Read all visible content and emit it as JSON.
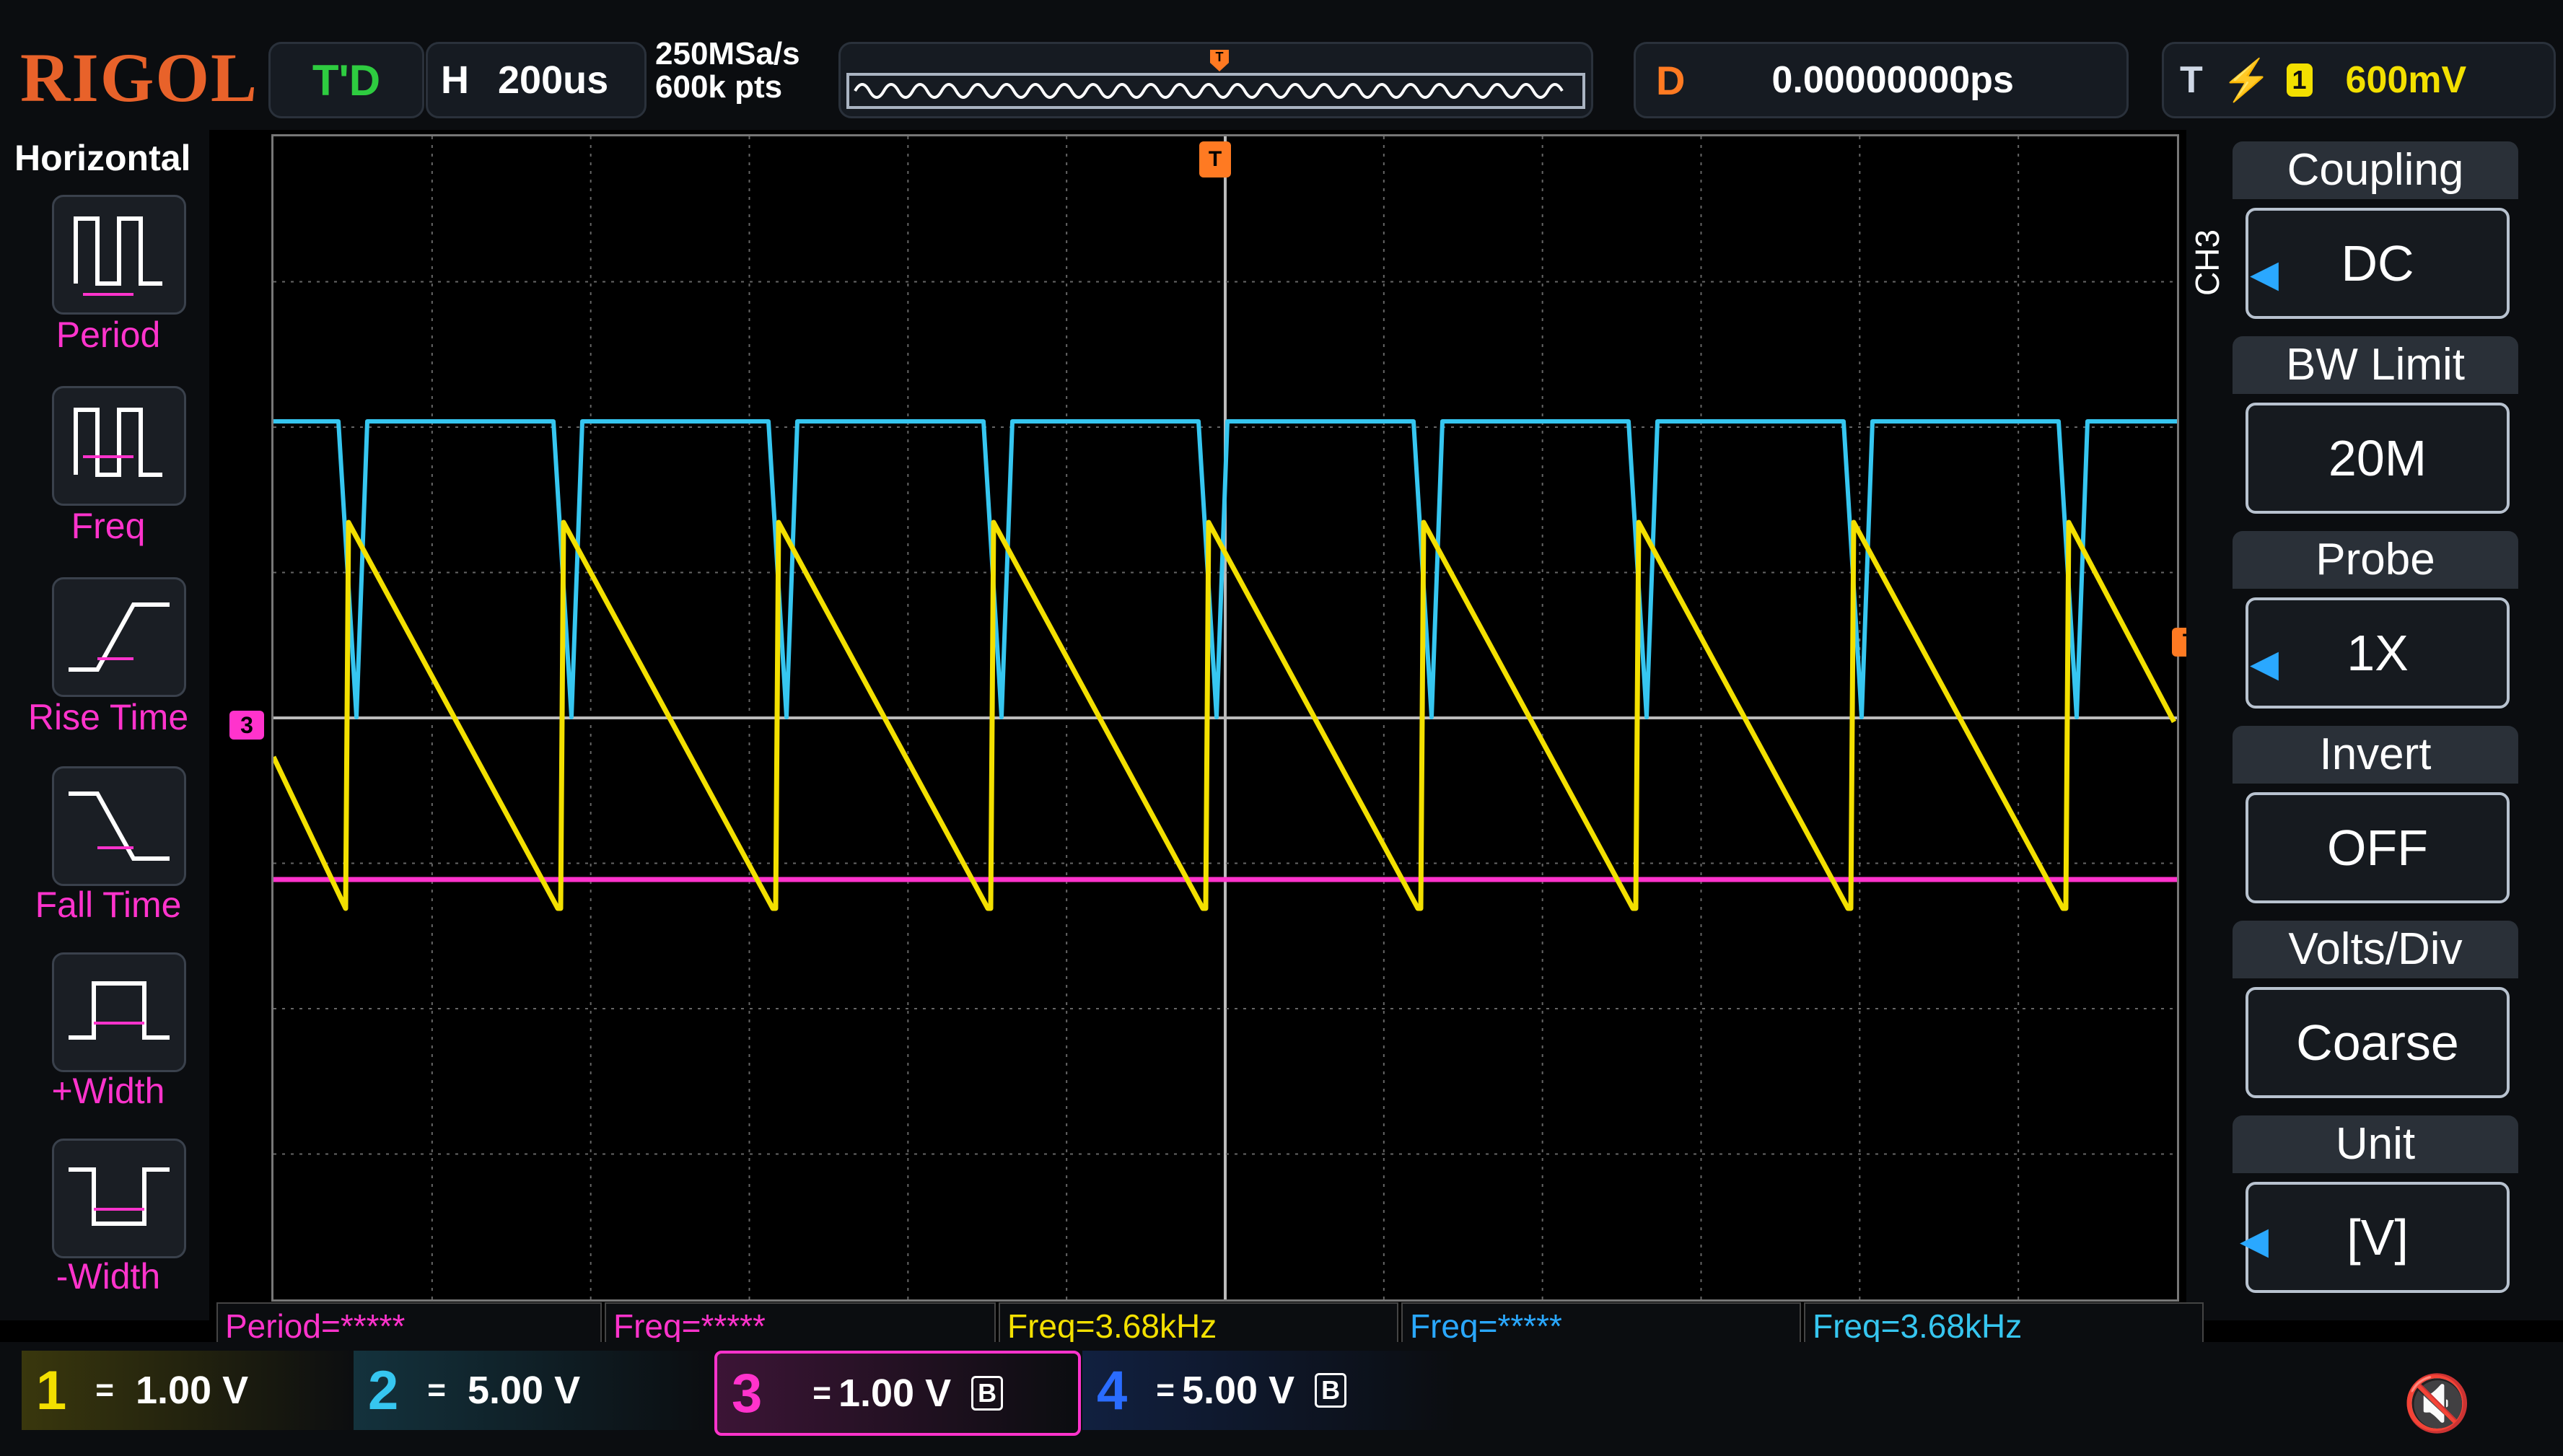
{
  "brand": "RIGOL",
  "top": {
    "run_state": "T'D",
    "timebase_label": "H",
    "timebase": "200us",
    "sample_rate": "250MSa/s",
    "memory_depth": "600k pts",
    "delay_label": "D",
    "delay": "0.00000000ps",
    "trigger_label": "T",
    "trigger_source": "1",
    "trigger_level": "600mV"
  },
  "left_menu": {
    "title": "Horizontal",
    "items": [
      {
        "label": "Period",
        "icon": "period-icon"
      },
      {
        "label": "Freq",
        "icon": "frequency-icon"
      },
      {
        "label": "Rise Time",
        "icon": "rise-time-icon"
      },
      {
        "label": "Fall Time",
        "icon": "fall-time-icon"
      },
      {
        "label": "+Width",
        "icon": "positive-width-icon"
      },
      {
        "label": "-Width",
        "icon": "negative-width-icon"
      }
    ]
  },
  "right_menu": {
    "channel_tag": "CH3",
    "items": [
      {
        "header": "Coupling",
        "value": "DC"
      },
      {
        "header": "BW Limit",
        "value": "20M"
      },
      {
        "header": "Probe",
        "value": "1X"
      },
      {
        "header": "Invert",
        "value": "OFF"
      },
      {
        "header": "Volts/Div",
        "value": "Coarse"
      },
      {
        "header": "Unit",
        "value": "[V]"
      }
    ]
  },
  "measurements": [
    {
      "text": "Period=*****",
      "color": "#ff33cc"
    },
    {
      "text": "Freq=*****",
      "color": "#ff33cc"
    },
    {
      "text": "Freq=3.68kHz",
      "color": "#f3e000"
    },
    {
      "text": "Freq=*****",
      "color": "#2aa8ff"
    },
    {
      "text": "Freq=3.68kHz",
      "color": "#36c6f0"
    }
  ],
  "channels": [
    {
      "num": "1",
      "coupling": "=",
      "scale": "1.00 V",
      "color": "#f3e000"
    },
    {
      "num": "2",
      "coupling": "=",
      "scale": "5.00 V",
      "color": "#36c6f0"
    },
    {
      "num": "3",
      "coupling": "=",
      "scale": "1.00 V",
      "color": "#ff33cc",
      "bw": "B"
    },
    {
      "num": "4",
      "coupling": "=",
      "scale": "5.00 V",
      "color": "#2a6cff",
      "bw": "B"
    }
  ],
  "markers": {
    "trigger_pos": "T",
    "ch3_marker": "3",
    "trigger_level_marker": "T"
  }
}
